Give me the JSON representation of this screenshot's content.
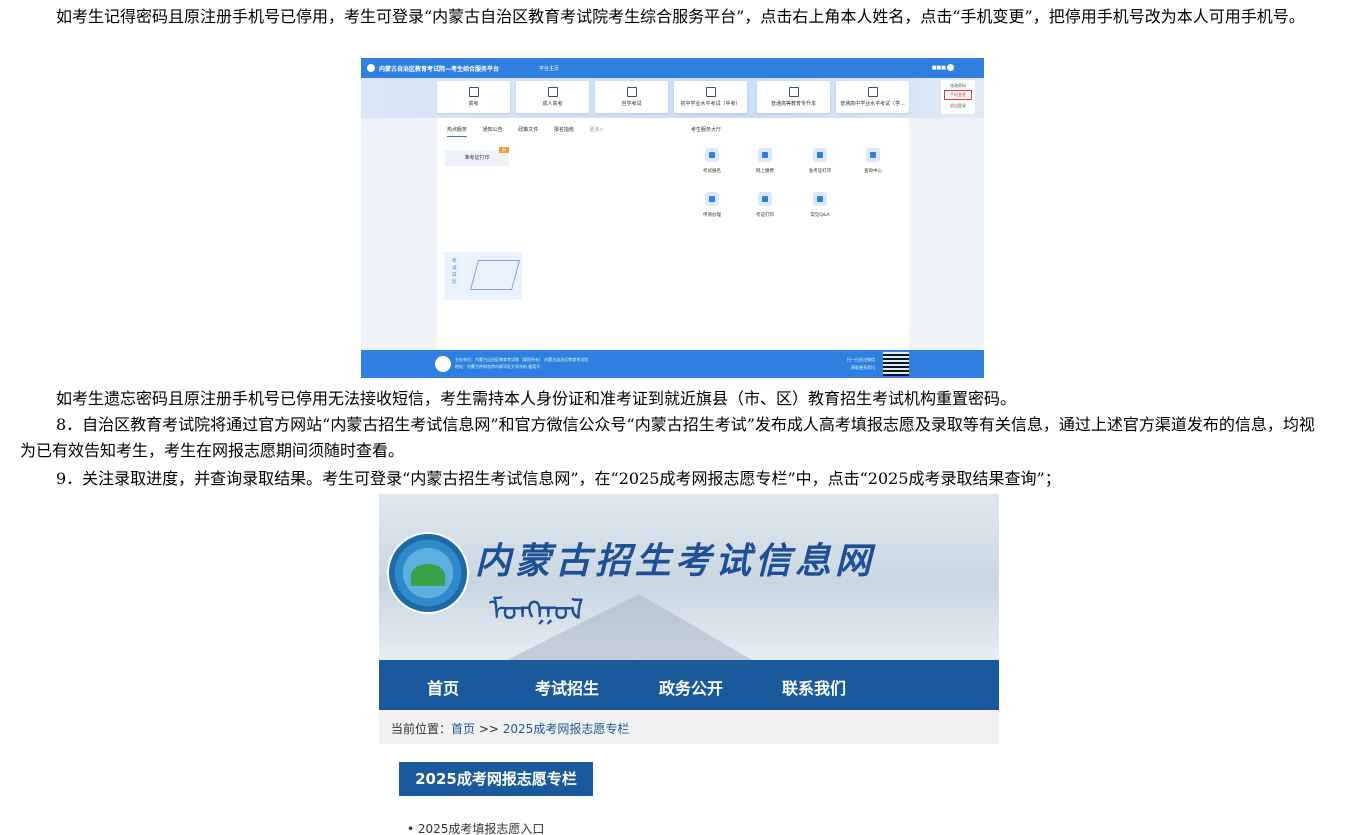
{
  "paragraphs": {
    "p1": "如考生记得密码且原注册手机号已停用，考生可登录“内蒙古自治区教育考试院考生综合服务平台”，点击右上角本人姓名，点击“手机变更”，把停用手机号改为本人可用手机号。",
    "p2": "如考生遗忘密码且原注册手机号已停用无法接收短信，考生需持本人身份证和准考证到就近旗县（市、区）教育招生考试机构重置密码。",
    "p3": "8．自治区教育考试院将通过官方网站“内蒙古招生考试信息网”和官方微信公众号“内蒙古招生考试”发布成人高考填报志愿及录取等有关信息，通过上述官方渠道发布的信息，均视为已有效告知考生，考生在网报志愿期间须随时查看。",
    "p4": "9．关注录取进度，并查询录取结果。考生可登录“内蒙古招生考试信息网”，在“2025成考网报志愿专栏”中，点击“2025成考录取结果查询”；"
  },
  "shot1": {
    "title": "内蒙古自治区教育考试院—考生综合服务平台",
    "home": "平台主页",
    "user": "■■■",
    "cards": [
      "高考",
      "成人高考",
      "自学考试",
      "初中学业水平考试（中考）",
      "普通高等教育专升本",
      "普通高中学业水平考试（学..."
    ],
    "user_menu": [
      "修改密码",
      "手机变更",
      "退出登录"
    ],
    "tabs": [
      "热点服务",
      "通知公告",
      "政策文件",
      "报名指南",
      "更多>"
    ],
    "hall": "考生服务大厅",
    "ticket": "准考证打印",
    "ticket_tag": "新",
    "services": [
      "考试报名",
      "网上缴费",
      "准考证打印",
      "查询中心",
      "申请办理",
      "考证打印",
      "常见Q&A"
    ],
    "illu_text": "考试日历",
    "footer": {
      "line1": "主办单位：内蒙古自治区教育考试院（版权所有） 内蒙古自治区教育考试院",
      "line2": "地址：内蒙古呼和浩特市赛罕区大学东街 备案号",
      "qr1": "扫一扫关注微信",
      "qr2": "获取更多资讯"
    }
  },
  "shot2": {
    "site_name": "内蒙古招生考试信息网",
    "mongol": "ᠮᠣᠩᠭᠣᠯ",
    "nav": [
      "首页",
      "考试招生",
      "政务公开",
      "联系我们"
    ],
    "crumb_label": "当前位置：",
    "crumb_home": "首页",
    "crumb_sep": " >> ",
    "crumb_current": "2025成考网报志愿专栏",
    "panel_title": "2025成考网报志愿专栏",
    "panel_item": "• 2025成考填报志愿入口"
  },
  "colors": {
    "platform_blue": "#2f7fe0",
    "site_blue": "#1a5a9c",
    "highlight_red": "#e33"
  }
}
